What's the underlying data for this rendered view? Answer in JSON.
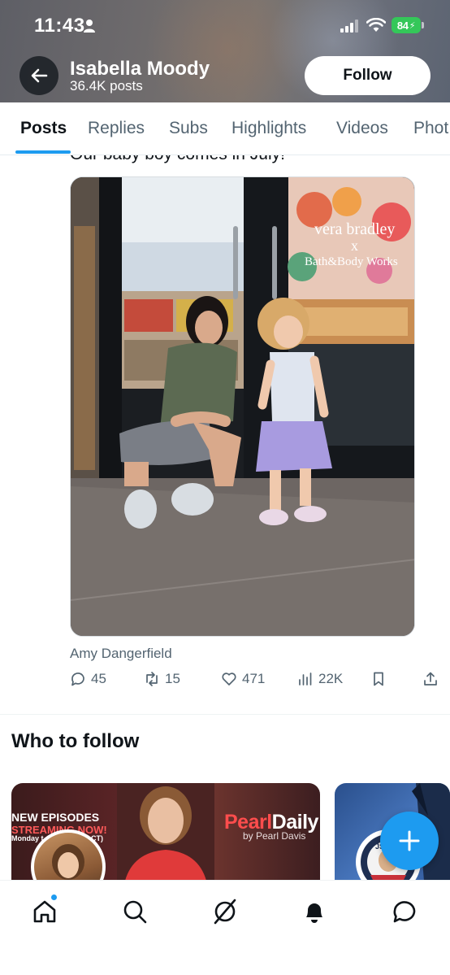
{
  "status_bar": {
    "time": "11:43",
    "battery": "84"
  },
  "profile": {
    "name": "Isabella Moody",
    "posts_count": "36.4K posts",
    "follow_label": "Follow"
  },
  "tabs": [
    {
      "label": "Posts",
      "active": true
    },
    {
      "label": "Replies",
      "active": false
    },
    {
      "label": "Subs",
      "active": false
    },
    {
      "label": "Highlights",
      "active": false
    },
    {
      "label": "Videos",
      "active": false
    },
    {
      "label": "Phot",
      "active": false
    }
  ],
  "post": {
    "text": "Our baby boy comes in July!",
    "media_credit": "Amy Dangerfield",
    "image_sign_text_1": "vera bradley",
    "image_sign_text_2": "x",
    "image_sign_text_3": "Bath&Body Works",
    "actions": {
      "replies": "45",
      "reposts": "15",
      "likes": "471",
      "views": "22K"
    }
  },
  "who_to_follow": {
    "title": "Who to follow",
    "cards": [
      {
        "headline": "NEW EPISODES",
        "headline2": "STREAMING NOW!",
        "small_text": "Monday t",
        "small_text2": "CT)",
        "brand_part1": "Pearl",
        "brand_part2": "Daily",
        "brand_sub": "by Pearl Davis"
      },
      {
        "badge": "JS"
      }
    ]
  },
  "nav": {
    "items": [
      "home-icon",
      "search-icon",
      "grok-icon",
      "notifications-icon",
      "messages-icon"
    ]
  },
  "colors": {
    "accent": "#1d9bf0",
    "text_primary": "#0f1419",
    "text_secondary": "#536471",
    "battery": "#34c759"
  }
}
